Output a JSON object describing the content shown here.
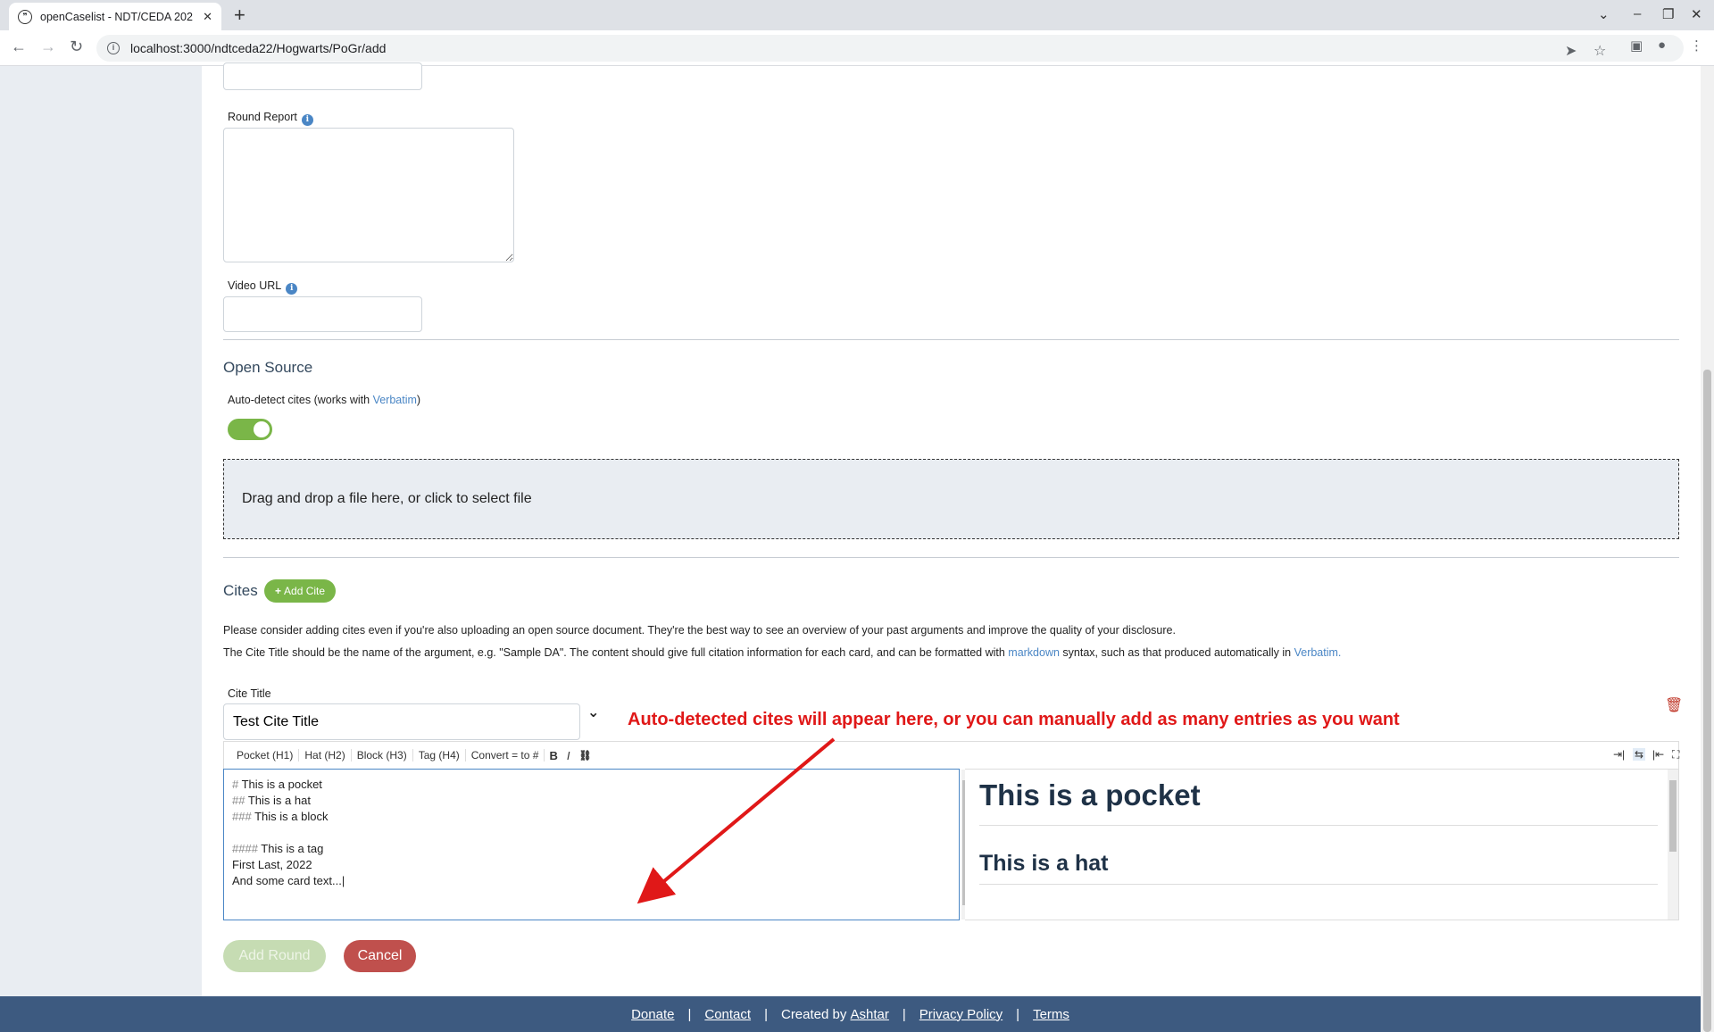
{
  "browser": {
    "tab_title": "openCaselist - NDT/CEDA 202",
    "new_tab": "+",
    "url": "localhost:3000/ndtceda22/Hogwarts/PoGr/add"
  },
  "form": {
    "round_report_label": "Round Report",
    "video_url_label": "Video URL",
    "video_url_value": "",
    "round_report_value": ""
  },
  "open_source": {
    "title": "Open Source",
    "autodetect_prefix": "Auto-detect cites (works with ",
    "autodetect_link": "Verbatim",
    "autodetect_suffix": ")",
    "toggle_on": true,
    "dropzone_text": "Drag and drop a file here, or click to select file"
  },
  "cites": {
    "title": "Cites",
    "add_cite_label": "Add Cite",
    "para1": "Please consider adding cites even if you're also uploading an open source document. They're the best way to see an overview of your past arguments and improve the quality of your disclosure.",
    "para2_a": "The Cite Title should be the name of the argument, e.g. \"Sample DA\". The content should give full citation information for each card, and can be formatted with ",
    "para2_link1": "markdown",
    "para2_b": " syntax, such as that produced automatically in ",
    "para2_link2": "Verbatim.",
    "cite_title_label": "Cite Title",
    "cite_title_value": "Test Cite Title",
    "toolbar": {
      "pocket": "Pocket (H1)",
      "hat": "Hat (H2)",
      "block": "Block (H3)",
      "tag": "Tag (H4)",
      "convert": "Convert = to #",
      "bold": "B",
      "italic": "I",
      "link": "🔗"
    },
    "editor_lines": {
      "l1_hash": "# ",
      "l1_text": "This is a pocket",
      "l2_hash": "## ",
      "l2_text": "This is a hat",
      "l3_hash": "### ",
      "l3_text": "This is a block",
      "l5_hash": "#### ",
      "l5_text": "This is a tag",
      "l6": "First Last, 2022",
      "l7": "And some card text...|"
    },
    "preview": {
      "h1": "This is a pocket",
      "h2": "This is a hat"
    }
  },
  "annotation": "Auto-detected cites will appear here, or you can manually add as many entries as you want",
  "actions": {
    "add_round": "Add Round",
    "cancel": "Cancel"
  },
  "footer": {
    "donate": "Donate",
    "contact": "Contact",
    "created_by": "Created by ",
    "author": "Ashtar",
    "privacy": "Privacy Policy",
    "terms": "Terms",
    "sep": "|"
  },
  "colors": {
    "accent_green": "#7ab648",
    "danger_red": "#c0504d",
    "footer_bg": "#3d5a80",
    "annotation_red": "#e01818"
  }
}
